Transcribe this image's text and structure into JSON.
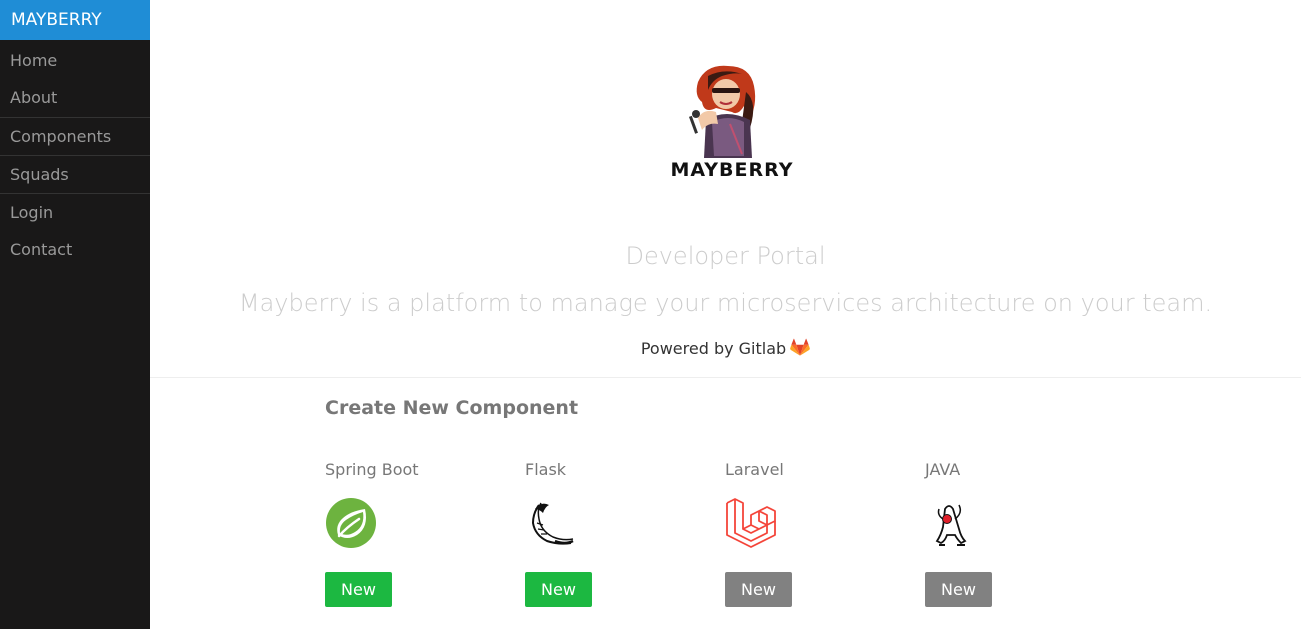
{
  "sidebar": {
    "brand": "MAYBERRY",
    "items": [
      {
        "label": "Home"
      },
      {
        "label": "About"
      },
      {
        "label": "Components"
      },
      {
        "label": "Squads"
      },
      {
        "label": "Login"
      },
      {
        "label": "Contact"
      }
    ]
  },
  "header": {
    "logo_text": "MAYBERRY",
    "title": "Developer Portal",
    "subtitle": "Mayberry is a platform to manage your microservices architecture on your team.",
    "powered_by": "Powered by Gitlab",
    "powered_icon": "gitlab-icon"
  },
  "section": {
    "title": "Create New Component",
    "components": [
      {
        "name": "Spring Boot",
        "icon": "spring-boot-icon",
        "button": "New",
        "button_color": "#1cb841"
      },
      {
        "name": "Flask",
        "icon": "flask-icon",
        "button": "New",
        "button_color": "#1cb841"
      },
      {
        "name": "Laravel",
        "icon": "laravel-icon",
        "button": "New",
        "button_color": "#818181"
      },
      {
        "name": "JAVA",
        "icon": "java-duke-icon",
        "button": "New",
        "button_color": "#818181"
      }
    ]
  },
  "colors": {
    "brand": "#1f8dd6",
    "sidebar_bg": "#191818",
    "green": "#1cb841",
    "gray": "#818181"
  }
}
